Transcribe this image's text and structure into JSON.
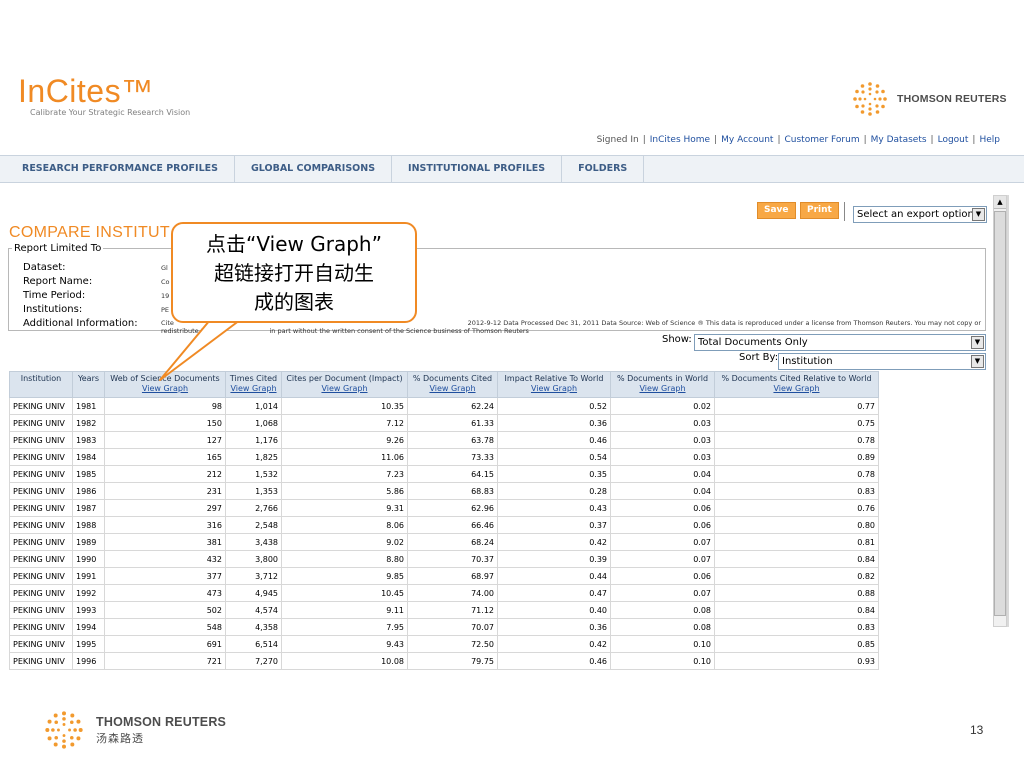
{
  "brand": {
    "name": "InCites™",
    "tagline": "Calibrate Your Strategic Research Vision",
    "partner": "THOMSON REUTERS"
  },
  "top_links": {
    "signed_in": "Signed In",
    "items": [
      "InCites Home",
      "My Account",
      "Customer Forum",
      "My Datasets",
      "Logout",
      "Help"
    ]
  },
  "nav": {
    "tabs": [
      "RESEARCH PERFORMANCE PROFILES",
      "GLOBAL COMPARISONS",
      "INSTITUTIONAL PROFILES",
      "FOLDERS"
    ]
  },
  "toolbar": {
    "save_label": "Save",
    "print_label": "Print",
    "export_placeholder": "Select an export option"
  },
  "page_title": "COMPARE INSTITUT",
  "report": {
    "legend": "Report Limited To",
    "labels": {
      "dataset": "Dataset:",
      "report_name": "Report Name:",
      "time_period": "Time Period:",
      "institutions": "Institutions:",
      "additional": "Additional Information:"
    },
    "values": {
      "dataset": "Gl",
      "report_name": "Co",
      "time_period": "19",
      "institutions": "PE",
      "additional_prefix": "Cite",
      "additional_main": "2012-9-12 Data Processed Dec 31, 2011 Data Source: Web of Science ® This data is reproduced under a license from Thomson Reuters. You may not copy or",
      "additional_line2a": "redistribute th",
      "additional_line2b": "in part without the written consent of the Science business of Thomson Reuters"
    }
  },
  "callout": {
    "line1": "点击“View Graph”",
    "line2": "超链接打开自动生",
    "line3": "成的图表"
  },
  "filters": {
    "show_label": "Show:",
    "show_value": "Total Documents Only",
    "sort_label": "Sort By:",
    "sort_value": "Institution"
  },
  "table": {
    "view_graph_label": "View Graph",
    "columns": [
      {
        "label": "Institution",
        "graph": false
      },
      {
        "label": "Years",
        "graph": false
      },
      {
        "label": "Web of Science Documents",
        "graph": true
      },
      {
        "label": "Times Cited",
        "graph": true
      },
      {
        "label": "Cites per Document (Impact)",
        "graph": true
      },
      {
        "label": "% Documents Cited",
        "graph": true
      },
      {
        "label": "Impact Relative To World",
        "graph": true
      },
      {
        "label": "% Documents in World",
        "graph": true
      },
      {
        "label": "% Documents Cited Relative to World",
        "graph": true
      }
    ],
    "rows": [
      [
        "PEKING UNIV",
        "1981",
        "98",
        "1,014",
        "10.35",
        "62.24",
        "0.52",
        "0.02",
        "0.77"
      ],
      [
        "PEKING UNIV",
        "1982",
        "150",
        "1,068",
        "7.12",
        "61.33",
        "0.36",
        "0.03",
        "0.75"
      ],
      [
        "PEKING UNIV",
        "1983",
        "127",
        "1,176",
        "9.26",
        "63.78",
        "0.46",
        "0.03",
        "0.78"
      ],
      [
        "PEKING UNIV",
        "1984",
        "165",
        "1,825",
        "11.06",
        "73.33",
        "0.54",
        "0.03",
        "0.89"
      ],
      [
        "PEKING UNIV",
        "1985",
        "212",
        "1,532",
        "7.23",
        "64.15",
        "0.35",
        "0.04",
        "0.78"
      ],
      [
        "PEKING UNIV",
        "1986",
        "231",
        "1,353",
        "5.86",
        "68.83",
        "0.28",
        "0.04",
        "0.83"
      ],
      [
        "PEKING UNIV",
        "1987",
        "297",
        "2,766",
        "9.31",
        "62.96",
        "0.43",
        "0.06",
        "0.76"
      ],
      [
        "PEKING UNIV",
        "1988",
        "316",
        "2,548",
        "8.06",
        "66.46",
        "0.37",
        "0.06",
        "0.80"
      ],
      [
        "PEKING UNIV",
        "1989",
        "381",
        "3,438",
        "9.02",
        "68.24",
        "0.42",
        "0.07",
        "0.81"
      ],
      [
        "PEKING UNIV",
        "1990",
        "432",
        "3,800",
        "8.80",
        "70.37",
        "0.39",
        "0.07",
        "0.84"
      ],
      [
        "PEKING UNIV",
        "1991",
        "377",
        "3,712",
        "9.85",
        "68.97",
        "0.44",
        "0.06",
        "0.82"
      ],
      [
        "PEKING UNIV",
        "1992",
        "473",
        "4,945",
        "10.45",
        "74.00",
        "0.47",
        "0.07",
        "0.88"
      ],
      [
        "PEKING UNIV",
        "1993",
        "502",
        "4,574",
        "9.11",
        "71.12",
        "0.40",
        "0.08",
        "0.84"
      ],
      [
        "PEKING UNIV",
        "1994",
        "548",
        "4,358",
        "7.95",
        "70.07",
        "0.36",
        "0.08",
        "0.83"
      ],
      [
        "PEKING UNIV",
        "1995",
        "691",
        "6,514",
        "9.43",
        "72.50",
        "0.42",
        "0.10",
        "0.85"
      ],
      [
        "PEKING UNIV",
        "1996",
        "721",
        "7,270",
        "10.08",
        "79.75",
        "0.46",
        "0.10",
        "0.93"
      ]
    ]
  },
  "footer": {
    "company_en": "THOMSON REUTERS",
    "company_cn": "汤森路透",
    "page_number": "13"
  },
  "colors": {
    "accent_orange": "#f08a24",
    "link_blue": "#1f4f9f",
    "nav_text": "#3d5d86",
    "header_bg": "#dbe4ee"
  },
  "icons": {
    "brand_logo": "thomson-reuters-dot-ring-icon",
    "select_arrow": "chevron-down-icon",
    "scroll_up": "scroll-up-arrow-icon"
  }
}
